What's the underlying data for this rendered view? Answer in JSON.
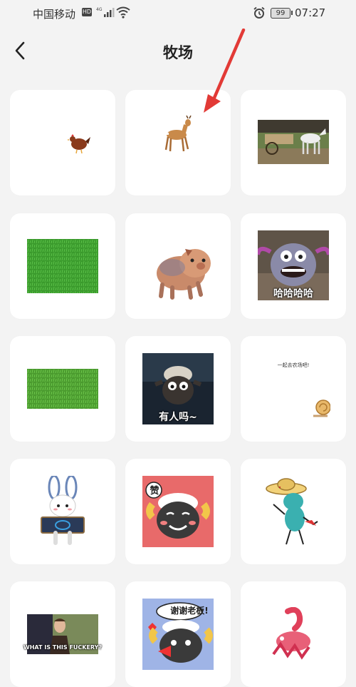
{
  "status_bar": {
    "carrier": "中国移动",
    "hd": "HD",
    "battery": "99",
    "time": "07:27"
  },
  "header": {
    "title": "牧场"
  },
  "stickers": [
    {
      "subject": "hen",
      "caption": ""
    },
    {
      "subject": "deer",
      "caption": ""
    },
    {
      "subject": "horse-cart",
      "caption": ""
    },
    {
      "subject": "grass",
      "caption": ""
    },
    {
      "subject": "pig",
      "caption": ""
    },
    {
      "subject": "monster",
      "caption": "哈哈哈哈"
    },
    {
      "subject": "grass",
      "caption": ""
    },
    {
      "subject": "sheep",
      "caption": "有人吗~"
    },
    {
      "subject": "snail",
      "caption": "一起去农场吧!"
    },
    {
      "subject": "rabbit",
      "caption": ""
    },
    {
      "subject": "sheep-cartoon",
      "caption": "赞"
    },
    {
      "subject": "dancing-dino",
      "caption": ""
    },
    {
      "subject": "man-photo",
      "caption": "WHAT IS THIS FUCKERY?"
    },
    {
      "subject": "sheep-cartoon",
      "caption": "谢谢老板!"
    },
    {
      "subject": "pink-creature",
      "caption": ""
    }
  ],
  "colors": {
    "background": "#f3f3f3",
    "card": "#ffffff",
    "arrow": "#e23a36"
  }
}
